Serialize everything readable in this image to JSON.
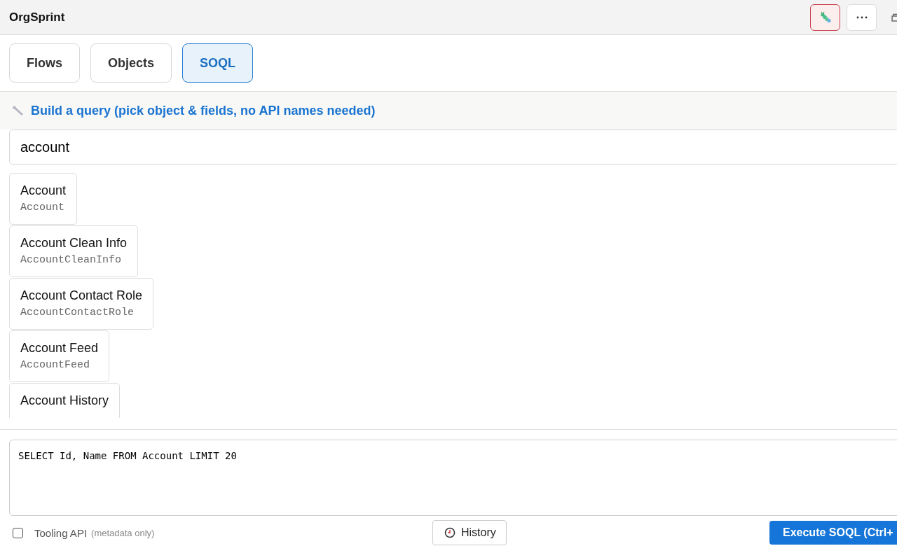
{
  "app": {
    "title": "OrgSprint"
  },
  "tabs": [
    {
      "label": "Flows",
      "selected": false
    },
    {
      "label": "Objects",
      "selected": false
    },
    {
      "label": "SOQL",
      "selected": true
    }
  ],
  "builder": {
    "heading": "Build a query (pick object & fields, no API names needed)"
  },
  "search": {
    "value": "account"
  },
  "objects": [
    {
      "label": "Account",
      "api_name": "Account"
    },
    {
      "label": "Account Clean Info",
      "api_name": "AccountCleanInfo"
    },
    {
      "label": "Account Contact Role",
      "api_name": "AccountContactRole"
    },
    {
      "label": "Account Feed",
      "api_name": "AccountFeed"
    },
    {
      "label": "Account History"
    }
  ],
  "query": {
    "value": "SELECT Id, Name FROM Account LIMIT 20"
  },
  "tooling": {
    "label": "Tooling API",
    "note": "(metadata only)",
    "checked": false
  },
  "history_button": "History",
  "execute_button": "Execute SOQL (Ctrl+"
}
